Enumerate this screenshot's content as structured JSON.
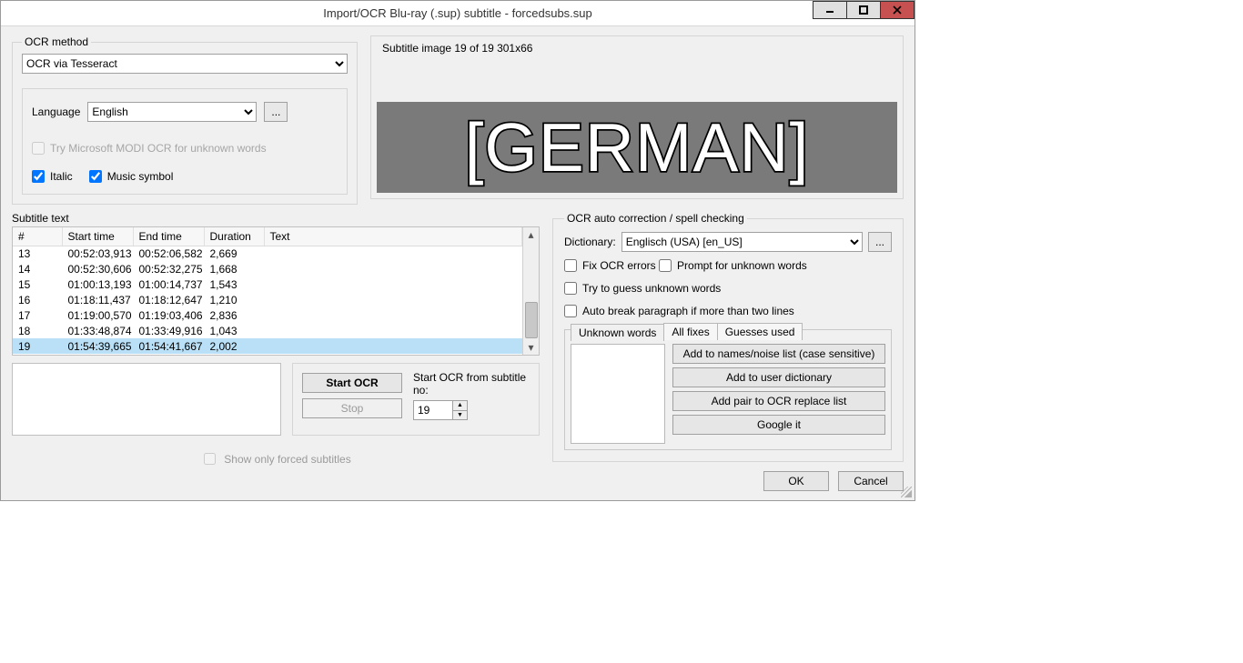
{
  "window": {
    "title": "Import/OCR Blu-ray (.sup) subtitle - forcedsubs.sup"
  },
  "ocr_method": {
    "legend": "OCR method",
    "selected": "OCR via Tesseract",
    "language_label": "Language",
    "language_selected": "English",
    "modi_label": "Try Microsoft MODI OCR for unknown words",
    "italic_label": "Italic",
    "music_label": "Music symbol"
  },
  "preview": {
    "label": "Subtitle image 19 of 19   301x66",
    "image_text": "[GERMAN]"
  },
  "subtitle_text": {
    "label": "Subtitle text",
    "headers": {
      "num": "#",
      "start": "Start time",
      "end": "End time",
      "dur": "Duration",
      "text": "Text"
    },
    "rows": [
      {
        "n": "13",
        "s": "00:52:03,913",
        "e": "00:52:06,582",
        "d": "2,669",
        "t": ""
      },
      {
        "n": "14",
        "s": "00:52:30,606",
        "e": "00:52:32,275",
        "d": "1,668",
        "t": ""
      },
      {
        "n": "15",
        "s": "01:00:13,193",
        "e": "01:00:14,737",
        "d": "1,543",
        "t": ""
      },
      {
        "n": "16",
        "s": "01:18:11,437",
        "e": "01:18:12,647",
        "d": "1,210",
        "t": ""
      },
      {
        "n": "17",
        "s": "01:19:00,570",
        "e": "01:19:03,406",
        "d": "2,836",
        "t": ""
      },
      {
        "n": "18",
        "s": "01:33:48,874",
        "e": "01:33:49,916",
        "d": "1,043",
        "t": ""
      },
      {
        "n": "19",
        "s": "01:54:39,665",
        "e": "01:54:41,667",
        "d": "2,002",
        "t": ""
      }
    ]
  },
  "ocr_ctrl": {
    "start": "Start OCR",
    "stop": "Stop",
    "from_label": "Start OCR from subtitle no:",
    "from_value": "19"
  },
  "forced_label": "Show only forced subtitles",
  "ocr_auto": {
    "legend": "OCR auto correction / spell checking",
    "dict_label": "Dictionary:",
    "dict_selected": "Englisch (USA) [en_US]",
    "fix_errors": "Fix OCR errors",
    "prompt_unknown": "Prompt for unknown words",
    "guess_unknown": "Try to guess unknown words",
    "auto_break": "Auto break paragraph if more than two lines",
    "tabs": {
      "unknown": "Unknown words",
      "fixes": "All fixes",
      "guesses": "Guesses used"
    },
    "buttons": {
      "add_names": "Add to names/noise list (case sensitive)",
      "add_user": "Add to user dictionary",
      "add_pair": "Add pair to OCR replace list",
      "google": "Google it"
    }
  },
  "dialog_buttons": {
    "ok": "OK",
    "cancel": "Cancel"
  }
}
